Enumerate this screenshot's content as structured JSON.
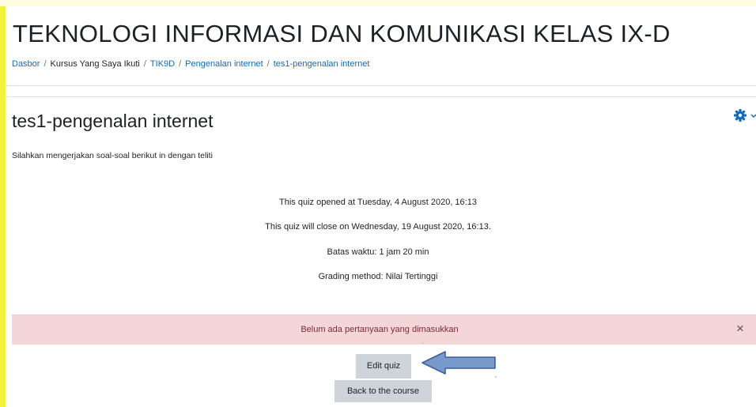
{
  "header": {
    "course_title": "TEKNOLOGI INFORMASI DAN KOMUNIKASI KELAS IX-D",
    "breadcrumb": [
      {
        "label": "Dasbor"
      },
      {
        "label": "Kursus Yang Saya Ikuti"
      },
      {
        "label": "TIK9D"
      },
      {
        "label": "Pengenalan internet"
      },
      {
        "label": "tes1-pengenalan internet"
      }
    ]
  },
  "main": {
    "quiz_title": "tes1-pengenalan internet",
    "settings_icon": "gear-icon",
    "intro": "Silahkan mengerjakan soal-soal berikut in dengan teliti",
    "info": [
      "This quiz opened at Tuesday, 4 August 2020, 16:13",
      "This quiz will close on Wednesday, 19 August 2020, 16:13.",
      "Batas waktu: 1 jam 20 min",
      "Grading method: Nilai Tertinggi"
    ],
    "alert": {
      "text": "Belum ada pertanyaan yang dimasukkan",
      "close": "×"
    },
    "buttons": {
      "edit_quiz": "Edit quiz",
      "back_to_course": "Back to the course"
    }
  },
  "colors": {
    "link": "#0f6cbf",
    "alert_bg": "#f4d6d9",
    "button_bg": "#ced4da",
    "arrow_fill": "#7799cc",
    "left_highlight": "#f4f23a"
  }
}
